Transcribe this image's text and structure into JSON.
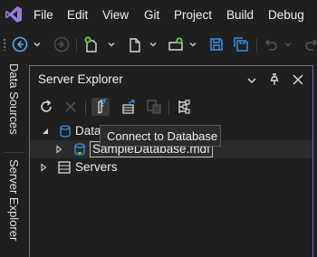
{
  "menubar": {
    "items": [
      "File",
      "Edit",
      "View",
      "Git",
      "Project",
      "Build",
      "Debug"
    ]
  },
  "side_tabs": {
    "data_sources": "Data Sources",
    "server_explorer": "Server Explorer"
  },
  "tool_window": {
    "title": "Server Explorer"
  },
  "tree": {
    "data_connections": "Data Connections",
    "sample_db": "SampleDatabase.mdf",
    "servers": "Servers"
  },
  "tooltip": "Connect to Database",
  "colors": {
    "accent": "#6f63c4",
    "vs_purple": "#9a7be0",
    "save_blue": "#3d8fe0",
    "add_green": "#6cc34e"
  }
}
